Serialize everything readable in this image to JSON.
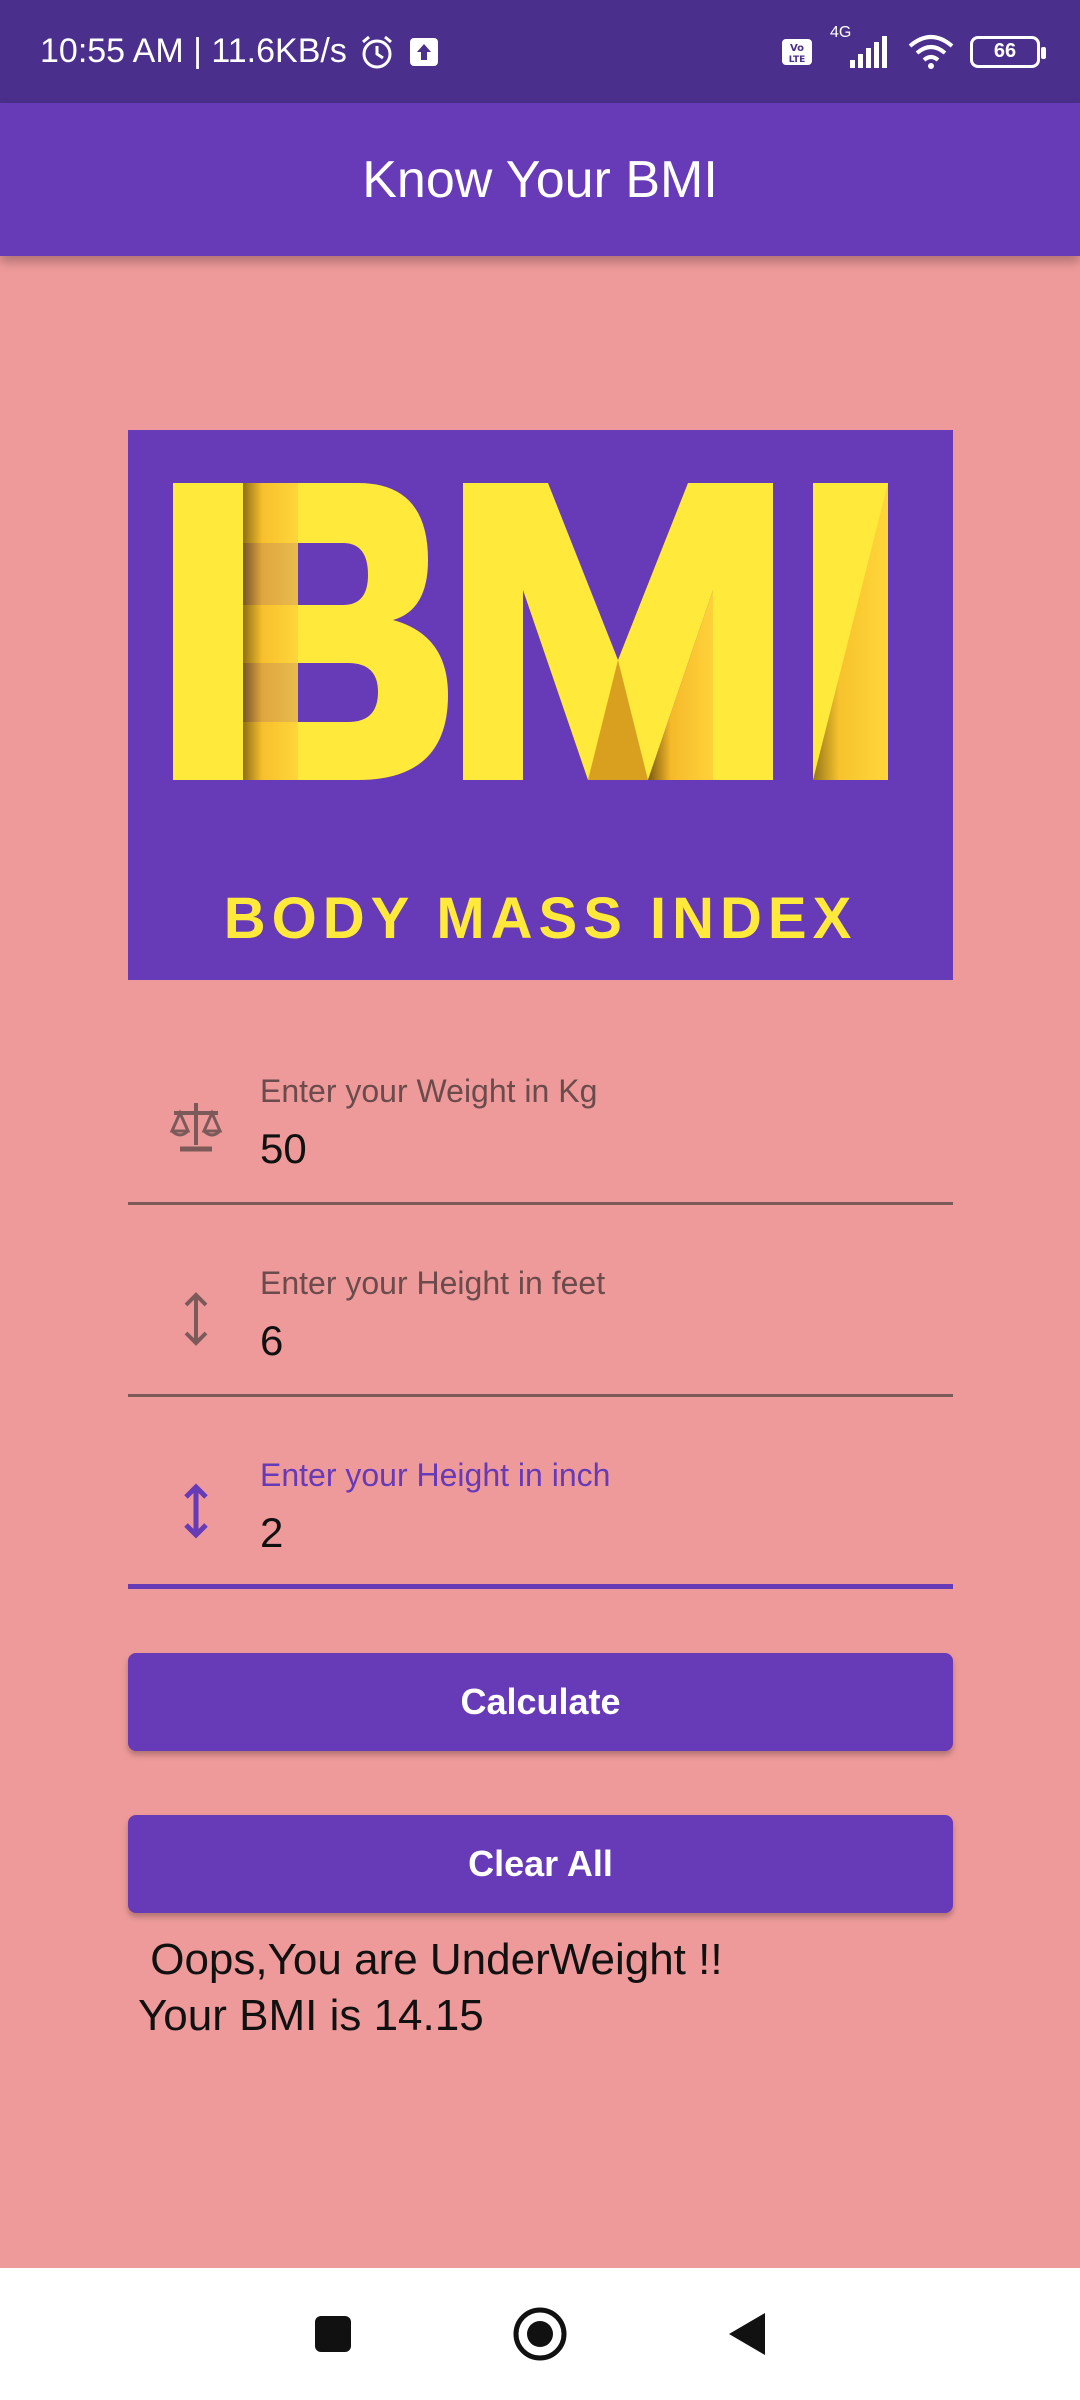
{
  "status_bar": {
    "time_speed": "10:55 AM | 11.6KB/s",
    "network": "4G",
    "battery": "66"
  },
  "app_bar": {
    "title": "Know Your BMI"
  },
  "logo": {
    "big_text": "BMI",
    "subtitle": "BODY MASS INDEX"
  },
  "form": {
    "weight": {
      "label": "Enter your Weight in Kg",
      "value": "50"
    },
    "height_feet": {
      "label": "Enter your Height in feet",
      "value": "6"
    },
    "height_inch": {
      "label": "Enter your Height in inch",
      "value": "2"
    }
  },
  "buttons": {
    "calculate": "Calculate",
    "clear": "Clear All"
  },
  "result": {
    "line1": " Oops,You are UnderWeight !!",
    "line2": "Your BMI is 14.15"
  },
  "colors": {
    "accent": "#673ab7",
    "background": "#ee9a9a",
    "logo_yellow": "#ffe93b"
  }
}
